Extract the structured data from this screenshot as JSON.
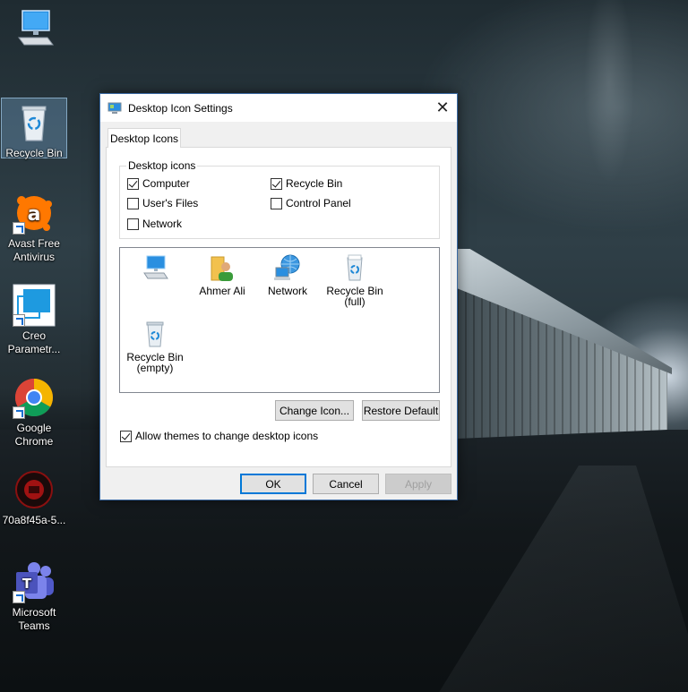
{
  "desktop": {
    "icons": [
      {
        "label": ""
      },
      {
        "label": "Recycle Bin"
      },
      {
        "label": "Avast Free Antivirus"
      },
      {
        "label": "Creo Parametr..."
      },
      {
        "label": "Google Chrome"
      },
      {
        "label": "70a8f45a-5..."
      },
      {
        "label": "Microsoft Teams"
      }
    ]
  },
  "dialog": {
    "title": "Desktop Icon Settings",
    "tab_label": "Desktop Icons",
    "group_label": "Desktop icons",
    "checkboxes": [
      {
        "label": "Computer",
        "checked": true
      },
      {
        "label": "Recycle Bin",
        "checked": true
      },
      {
        "label": "User's Files",
        "checked": false
      },
      {
        "label": "Control Panel",
        "checked": false
      },
      {
        "label": "Network",
        "checked": false
      }
    ],
    "icon_list": [
      {
        "label": ""
      },
      {
        "label": "Ahmer Ali"
      },
      {
        "label": "Network"
      },
      {
        "label": "Recycle Bin",
        "sub": "(full)"
      },
      {
        "label": "Recycle Bin",
        "sub": "(empty)"
      }
    ],
    "change_icon_label": "Change Icon...",
    "restore_default_label": "Restore Default",
    "allow_themes_label": "Allow themes to change desktop icons",
    "allow_themes_checked": true,
    "ok_label": "OK",
    "cancel_label": "Cancel",
    "apply_label": "Apply"
  },
  "colors": {
    "accent": "#0078d7",
    "dialog_border": "#3b6aa3"
  }
}
